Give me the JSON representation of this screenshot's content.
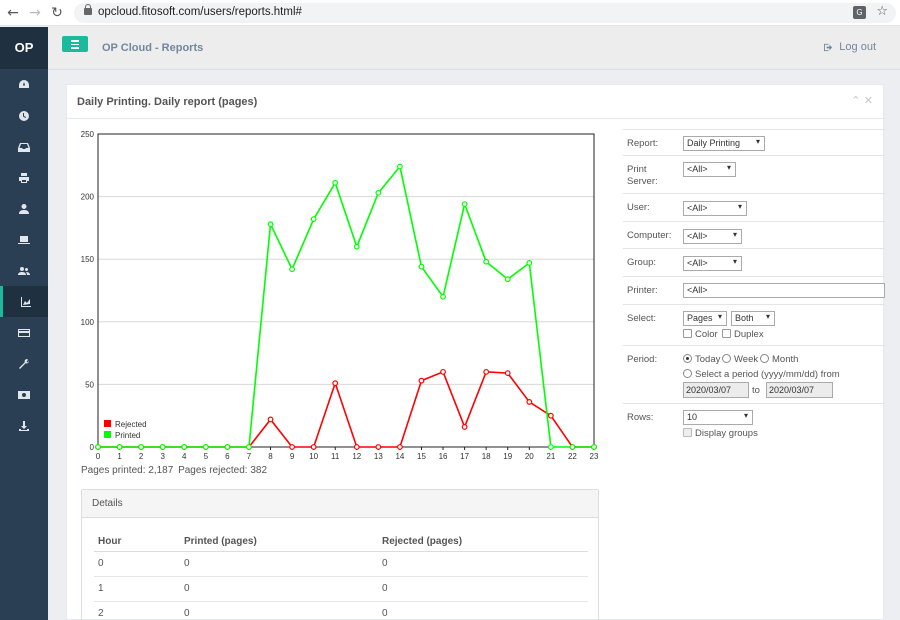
{
  "browser": {
    "url": "opcloud.fitosoft.com/users/reports.html#"
  },
  "sidebar": {
    "logo": "OP",
    "items": [
      {
        "icon": "dashboard-icon",
        "active": false
      },
      {
        "icon": "clock-icon",
        "active": false
      },
      {
        "icon": "inbox-icon",
        "active": false
      },
      {
        "icon": "printer-icon",
        "active": false
      },
      {
        "icon": "user-icon",
        "active": false
      },
      {
        "icon": "laptop-icon",
        "active": false
      },
      {
        "icon": "users-icon",
        "active": false
      },
      {
        "icon": "area-chart-icon",
        "active": true
      },
      {
        "icon": "credit-card-icon",
        "active": false
      },
      {
        "icon": "wrench-icon",
        "active": false
      },
      {
        "icon": "money-icon",
        "active": false
      },
      {
        "icon": "download-icon",
        "active": false
      }
    ]
  },
  "header": {
    "title": "OP Cloud - Reports",
    "logout_label": "Log out"
  },
  "panel": {
    "title": "Daily Printing. Daily report (pages)"
  },
  "chart_data": {
    "type": "line",
    "x": [
      0,
      1,
      2,
      3,
      4,
      5,
      6,
      7,
      8,
      9,
      10,
      11,
      12,
      13,
      14,
      15,
      16,
      17,
      18,
      19,
      20,
      21,
      22,
      23
    ],
    "xlim": [
      0,
      23
    ],
    "ylim": [
      0,
      250
    ],
    "yticks": [
      0,
      50,
      100,
      150,
      200,
      250
    ],
    "series": [
      {
        "name": "Rejected",
        "color": "#ff0000",
        "values": [
          0,
          0,
          0,
          0,
          0,
          0,
          0,
          0,
          22,
          0,
          0,
          51,
          0,
          0,
          0,
          53,
          60,
          16,
          60,
          59,
          36,
          25,
          0,
          0
        ]
      },
      {
        "name": "Printed",
        "color": "#00ff00",
        "values": [
          0,
          0,
          0,
          0,
          0,
          0,
          0,
          0,
          178,
          142,
          182,
          211,
          160,
          203,
          224,
          144,
          120,
          194,
          148,
          134,
          147,
          0,
          0,
          0
        ]
      }
    ],
    "legend": "bottom-left",
    "grid": true
  },
  "summary": {
    "printed": "Pages printed: 2,187",
    "rejected": "Pages rejected: 382"
  },
  "details": {
    "title": "Details",
    "headers": [
      "Hour",
      "Printed (pages)",
      "Rejected (pages)"
    ],
    "rows": [
      [
        "0",
        "0",
        "0"
      ],
      [
        "1",
        "0",
        "0"
      ],
      [
        "2",
        "0",
        "0"
      ]
    ]
  },
  "form": {
    "report_label": "Report:",
    "report_value": "Daily Printing",
    "print_server_label": "Print Server:",
    "print_server_value": "<All>",
    "user_label": "User:",
    "user_value": "<All>",
    "computer_label": "Computer:",
    "computer_value": "<All>",
    "group_label": "Group:",
    "group_value": "<All>",
    "printer_label": "Printer:",
    "printer_value": "<All>",
    "select_label": "Select:",
    "select_unit": "Pages",
    "select_which": "Both",
    "color_label": "Color",
    "duplex_label": "Duplex",
    "period_label": "Period:",
    "period_today": "Today",
    "period_week": "Week",
    "period_month": "Month",
    "period_custom": "Select a period (yyyy/mm/dd) from",
    "period_from": "2020/03/07",
    "period_to_label": "to",
    "period_to": "2020/03/07",
    "rows_label": "Rows:",
    "rows_value": "10",
    "display_groups_label": "Display groups"
  }
}
